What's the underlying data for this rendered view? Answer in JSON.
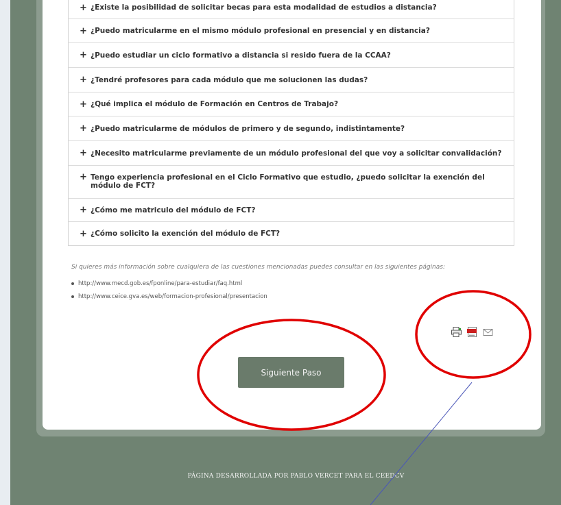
{
  "faq": {
    "items": [
      "¿Existe la posibilidad de solicitar becas para esta modalidad de estudios a distancia?",
      "¿Puedo matricularme en el mismo módulo profesional en presencial y en distancia?",
      "¿Puedo estudiar un ciclo formativo a distancia si resido fuera de la CCAA?",
      "¿Tendré profesores para cada módulo que me solucionen las dudas?",
      "¿Qué implica el módulo de Formación en Centros de Trabajo?",
      "¿Puedo matricularme de módulos de primero y de segundo, indistintamente?",
      "¿Necesito matricularme previamente de un módulo profesional del que voy a solicitar convalidación?",
      "Tengo experiencia profesional en el Ciclo Formativo que estudio, ¿puedo solicitar la exención del módulo de FCT?",
      "¿Cómo me matriculo del módulo de FCT?",
      "¿Cómo solicito la exención del módulo de FCT?"
    ]
  },
  "info": {
    "text": "Si quieres más información sobre cualquiera de las cuestiones mencionadas puedes consultar en las siguientes páginas:",
    "links": [
      "http://www.mecd.gob.es/fponline/para-estudiar/faq.html",
      "http://www.ceice.gva.es/web/formacion-profesional/presentacion"
    ]
  },
  "icons": [
    "print-icon",
    "pdf-icon",
    "email-icon"
  ],
  "next_button": "Siguiente Paso",
  "footer": "PÁGINA DESARROLLADA POR PABLO VERCET PARA EL CEEDCV",
  "colors": {
    "page_background": "#6f8372",
    "button": "#6a7b6b",
    "annotation": "#e00000"
  }
}
